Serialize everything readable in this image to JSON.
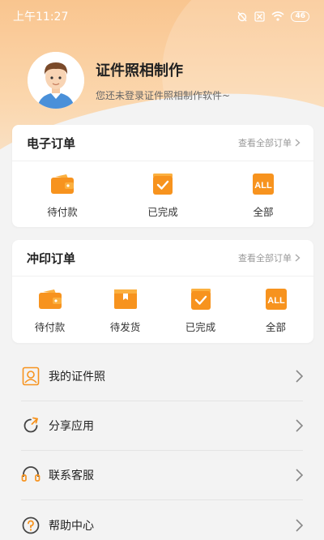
{
  "status_bar": {
    "time": "上午11:27",
    "battery": "46"
  },
  "profile": {
    "title": "证件照相制作",
    "subtitle": "您还未登录证件照相制作软件~"
  },
  "e_orders": {
    "title": "电子订单",
    "view_all": "查看全部订单",
    "items": [
      {
        "label": "待付款",
        "icon": "wallet-icon"
      },
      {
        "label": "已完成",
        "icon": "check-box-icon"
      },
      {
        "label": "全部",
        "icon": "all-icon"
      }
    ]
  },
  "print_orders": {
    "title": "冲印订单",
    "view_all": "查看全部订单",
    "items": [
      {
        "label": "待付款",
        "icon": "wallet-icon"
      },
      {
        "label": "待发货",
        "icon": "package-icon"
      },
      {
        "label": "已完成",
        "icon": "check-box-icon"
      },
      {
        "label": "全部",
        "icon": "all-icon"
      }
    ]
  },
  "menu": [
    {
      "label": "我的证件照",
      "icon": "id-photo-icon"
    },
    {
      "label": "分享应用",
      "icon": "share-icon"
    },
    {
      "label": "联系客服",
      "icon": "headset-icon"
    },
    {
      "label": "帮助中心",
      "icon": "help-icon"
    }
  ],
  "colors": {
    "accent": "#f7931e",
    "accent_light": "#fbb040",
    "header_bg": "#f9c58f"
  }
}
